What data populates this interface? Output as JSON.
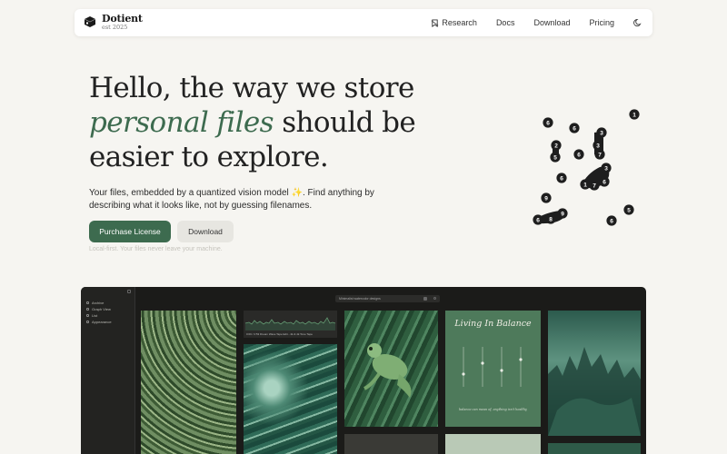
{
  "brand": {
    "name": "Dotient",
    "est": "est 2025"
  },
  "nav": {
    "items": [
      {
        "label": "Research",
        "icon": "bookmark-icon"
      },
      {
        "label": "Docs"
      },
      {
        "label": "Download"
      },
      {
        "label": "Pricing"
      }
    ],
    "theme_icon": "moon-icon"
  },
  "hero": {
    "title_line1": "Hello, the way we store",
    "title_line2_em": "personal files",
    "title_line2_rest": " should be",
    "title_line3": "easier to explore.",
    "subtitle": "Your files, embedded by a quantized vision model ✨. Find anything by describing what it looks like, not by guessing filenames.",
    "primary_button": "Purchase License",
    "secondary_button": "Download",
    "note": "Local-first. Your files never leave your machine."
  },
  "scatter": {
    "points": [
      "1",
      "6",
      "6",
      "3",
      "2",
      "3",
      "5",
      "6",
      "7",
      "6",
      "3",
      "1",
      "7",
      "6",
      "9",
      "5",
      "9",
      "8",
      "6",
      "6"
    ]
  },
  "app": {
    "sidebar": [
      "Archive",
      "Graph View",
      "List",
      "Appearance"
    ],
    "search_placeholder": "Minimalist watercolor designs",
    "waveform_title": "0:00 / 2:53  Dream Wave Tape Edit - 4k & 4k Tone Tape",
    "poster_title": "Living In Balance",
    "poster_footer": "balance can mean of, anything isn't healthy"
  },
  "colors": {
    "accent": "#3d6b4f",
    "background": "#f6f5f1",
    "app_background": "#1b1b19"
  }
}
